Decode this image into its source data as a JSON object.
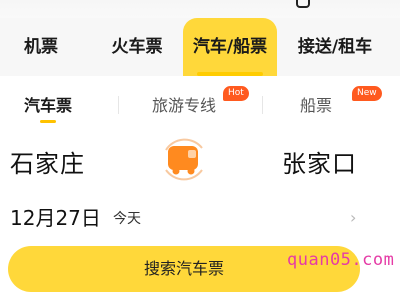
{
  "main_tabs": [
    {
      "label": "机票"
    },
    {
      "label": "火车票"
    },
    {
      "label": "汽车/船票"
    },
    {
      "label": "接送/租车"
    }
  ],
  "sub_tabs": [
    {
      "label": "汽车票"
    },
    {
      "label": "旅游专线",
      "badge": "Hot"
    },
    {
      "label": "船票",
      "badge": "New"
    }
  ],
  "route": {
    "from": "石家庄",
    "to": "张家口"
  },
  "date": {
    "value": "12月27日",
    "note": "今天"
  },
  "search_button": "搜索汽车票",
  "watermark": "quan05.com",
  "colors": {
    "accent": "#ffd83a",
    "badge": "#ff5a1f",
    "bus": "#ff8a1f"
  }
}
